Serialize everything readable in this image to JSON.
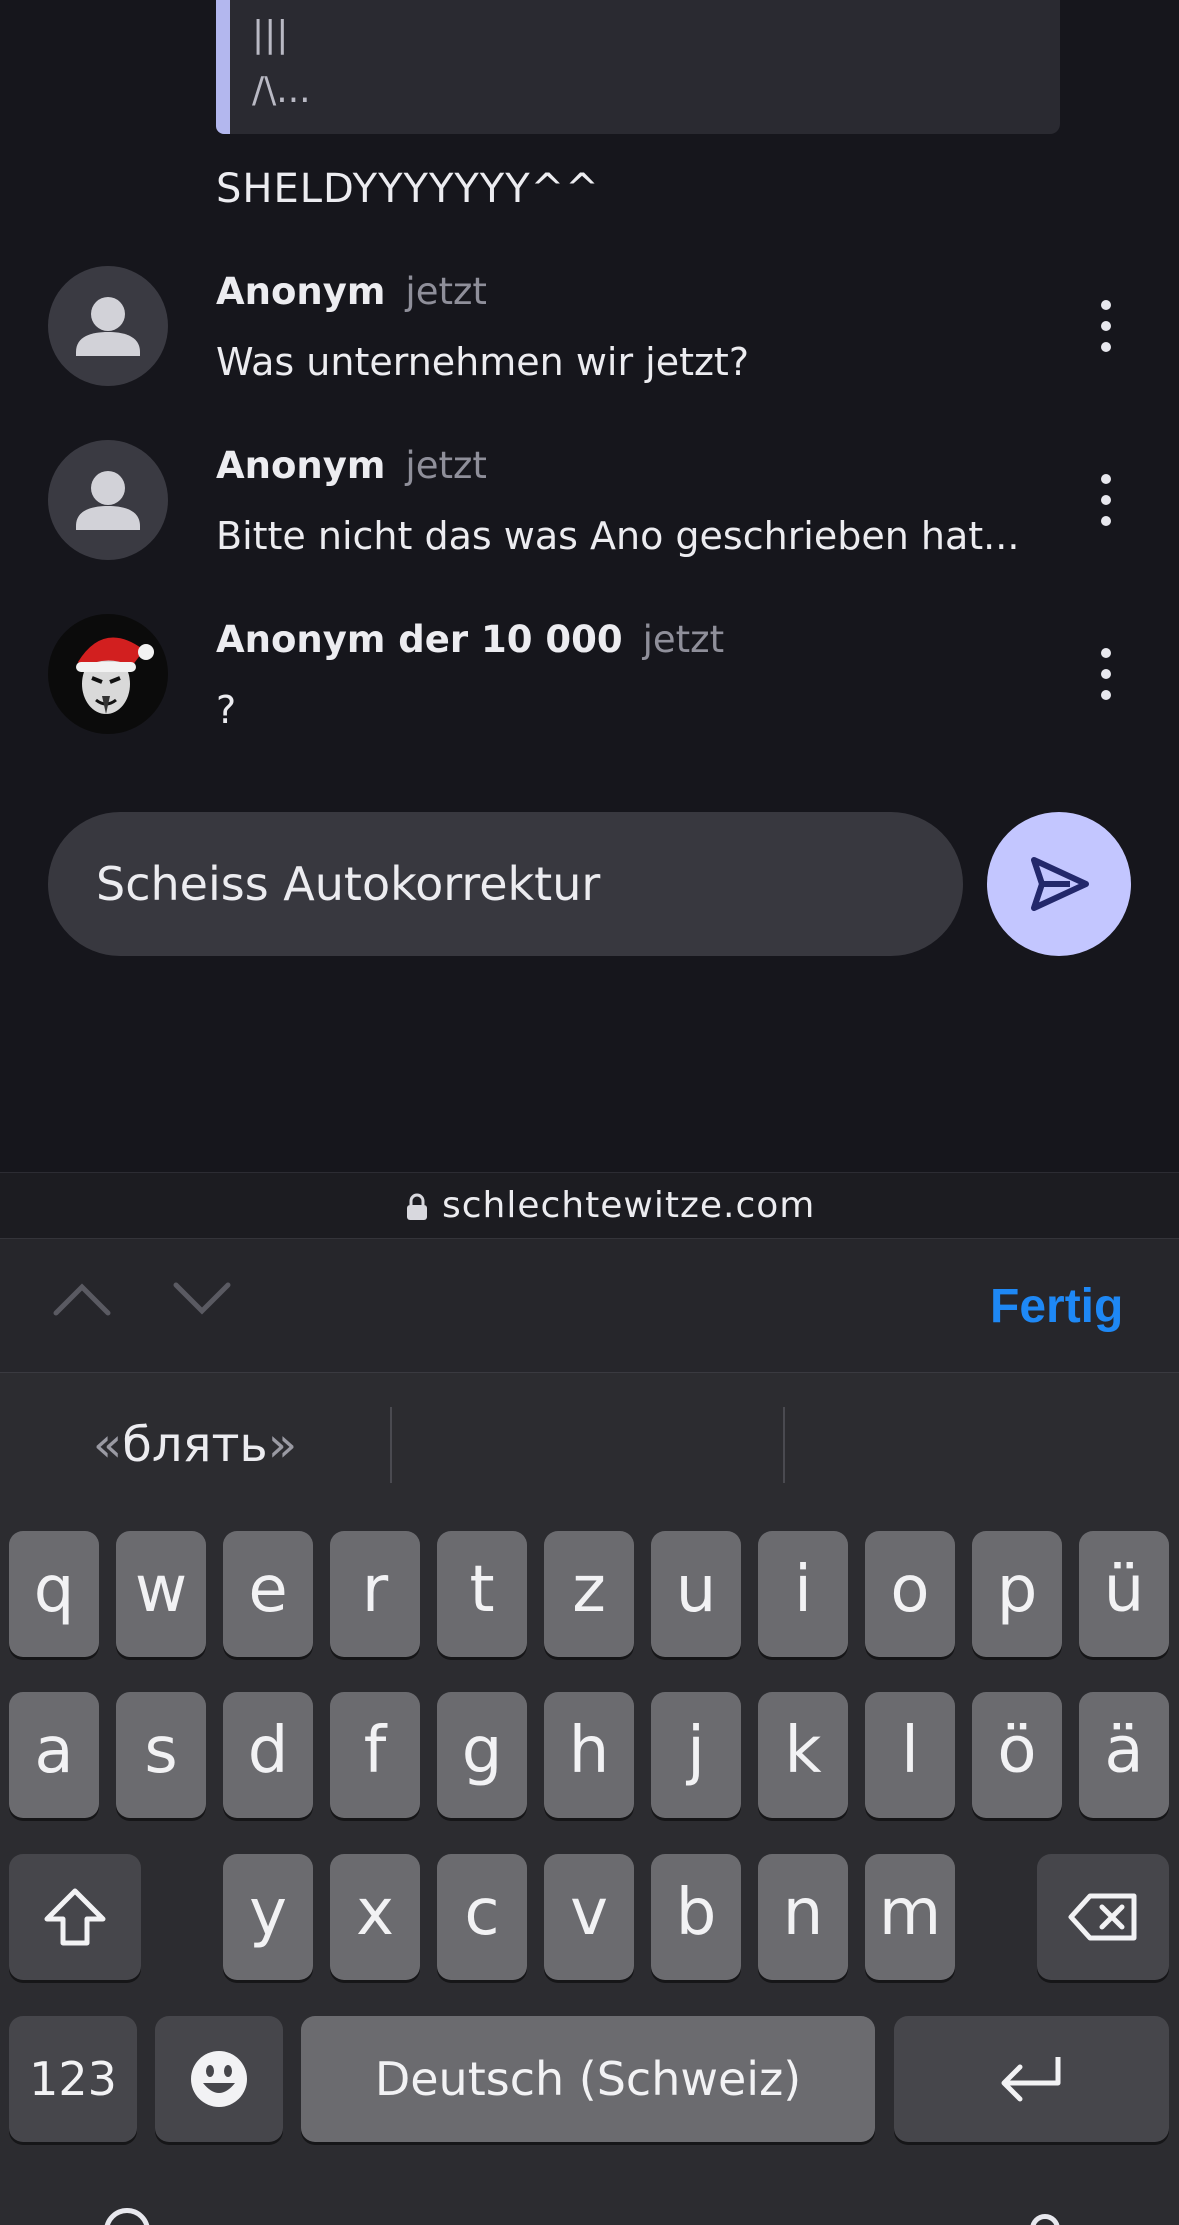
{
  "chat": {
    "quote_lines": [
      "|||",
      "/\\..."
    ],
    "plain_message": "SHELDYYYYYYY^^",
    "messages": [
      {
        "author": "Anonym",
        "time": "jetzt",
        "text": "Was unternehmen wir jetzt?",
        "avatar": "person-icon"
      },
      {
        "author": "Anonym",
        "time": "jetzt",
        "text": "Bitte nicht das was Ano geschrieben hat...",
        "avatar": "person-icon"
      },
      {
        "author": "Anonym der 10 000",
        "time": "jetzt",
        "text": "?",
        "avatar": "santa-mask-avatar"
      }
    ],
    "composer": {
      "value": "Scheiss Autokorrektur",
      "send_icon": "send-icon"
    }
  },
  "browser": {
    "url": "schlechtewitze.com",
    "lock_icon": "lock-icon"
  },
  "accessory": {
    "done_label": "Fertig",
    "up_icon": "chevron-up-icon",
    "down_icon": "chevron-down-icon"
  },
  "keyboard": {
    "suggestion": {
      "open": "«",
      "word": "блять",
      "close": "»"
    },
    "row1": [
      "q",
      "w",
      "e",
      "r",
      "t",
      "z",
      "u",
      "i",
      "o",
      "p",
      "ü"
    ],
    "row2": [
      "a",
      "s",
      "d",
      "f",
      "g",
      "h",
      "j",
      "k",
      "l",
      "ö",
      "ä"
    ],
    "row3": [
      "y",
      "x",
      "c",
      "v",
      "b",
      "n",
      "m"
    ],
    "numbers_label": "123",
    "space_label": "Deutsch (Schweiz)",
    "icons": [
      "shift-icon",
      "backspace-icon",
      "emoji-icon",
      "return-icon"
    ]
  }
}
